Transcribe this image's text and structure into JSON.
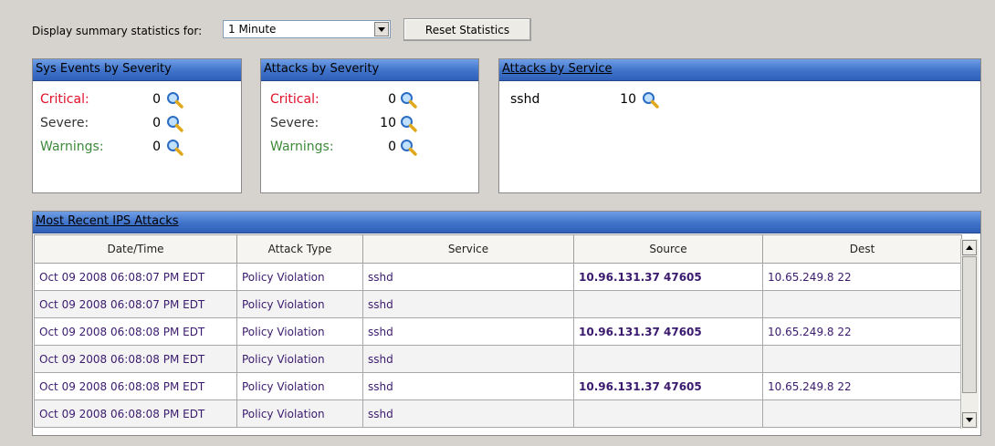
{
  "controls": {
    "label": "Display summary statistics for:",
    "period_value": "1 Minute",
    "reset_label": "Reset Statistics"
  },
  "sys_events": {
    "title": "Sys Events by Severity",
    "rows": [
      {
        "label": "Critical:",
        "value": "0"
      },
      {
        "label": "Severe:",
        "value": "0"
      },
      {
        "label": "Warnings:",
        "value": "0"
      }
    ]
  },
  "attacks_severity": {
    "title": "Attacks by Severity",
    "rows": [
      {
        "label": "Critical:",
        "value": "0"
      },
      {
        "label": "Severe:",
        "value": "10"
      },
      {
        "label": "Warnings:",
        "value": "0"
      }
    ]
  },
  "attacks_service": {
    "title": "Attacks by Service",
    "rows": [
      {
        "label": "sshd",
        "value": "10"
      }
    ]
  },
  "recent": {
    "title": "Most Recent IPS Attacks",
    "columns": [
      "Date/Time",
      "Attack Type",
      "Service",
      "Source",
      "Dest"
    ],
    "rows": [
      [
        "Oct 09 2008 06:08:07 PM EDT",
        "Policy Violation",
        "sshd",
        "10.96.131.37 47605",
        "10.65.249.8 22"
      ],
      [
        "Oct 09 2008 06:08:07 PM EDT",
        "Policy Violation",
        "sshd",
        "",
        ""
      ],
      [
        "Oct 09 2008 06:08:08 PM EDT",
        "Policy Violation",
        "sshd",
        "10.96.131.37 47605",
        "10.65.249.8 22"
      ],
      [
        "Oct 09 2008 06:08:08 PM EDT",
        "Policy Violation",
        "sshd",
        "",
        ""
      ],
      [
        "Oct 09 2008 06:08:08 PM EDT",
        "Policy Violation",
        "sshd",
        "10.96.131.37 47605",
        "10.65.249.8 22"
      ],
      [
        "Oct 09 2008 06:08:08 PM EDT",
        "Policy Violation",
        "sshd",
        "",
        ""
      ]
    ]
  },
  "icons": {
    "zoom": "magnifier-icon"
  },
  "colors": {
    "critical": "#e0102a",
    "warnings": "#3d8a3a",
    "header": "#3f73c9"
  }
}
